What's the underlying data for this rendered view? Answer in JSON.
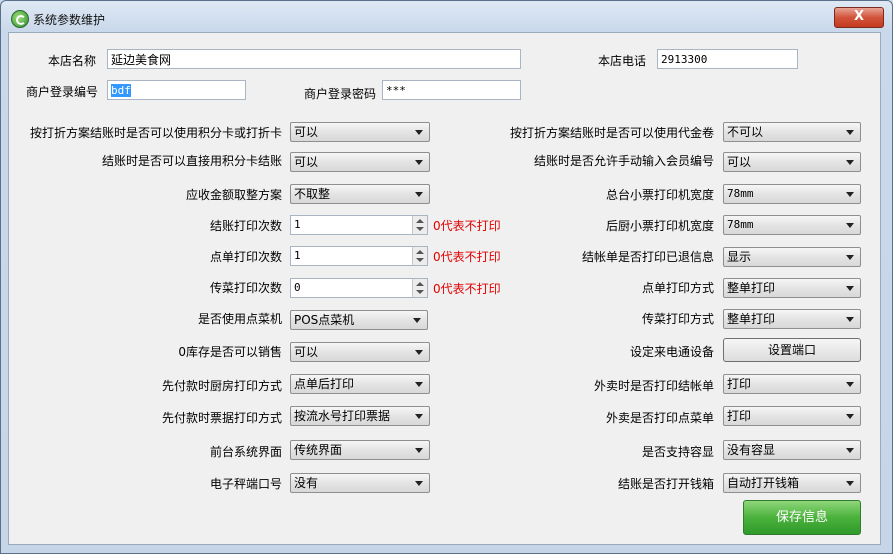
{
  "window": {
    "title": "系统参数维护",
    "close": "X"
  },
  "top": {
    "store_name_label": "本店名称",
    "store_name_value": "延边美食网",
    "store_phone_label": "本店电话",
    "store_phone_value": "2913300",
    "merchant_id_label": "商户登录编号",
    "merchant_id_value": "bdf",
    "merchant_pw_label": "商户登录密码",
    "merchant_pw_value": "***"
  },
  "left": [
    {
      "label": "按打折方案结账时是否可以使用积分卡或打折卡",
      "value": "可以"
    },
    {
      "label": "结账时是否可以直接用积分卡结账",
      "value": "可以"
    },
    {
      "label": "应收金额取整方案",
      "value": "不取整"
    },
    {
      "label": "结账打印次数",
      "value": "1",
      "note": "0代表不打印"
    },
    {
      "label": "点单打印次数",
      "value": "1",
      "note": "0代表不打印"
    },
    {
      "label": "传菜打印次数",
      "value": "0",
      "note": "0代表不打印"
    },
    {
      "label": "是否使用点菜机",
      "value": "POS点菜机"
    },
    {
      "label": "0库存是否可以销售",
      "value": "可以"
    },
    {
      "label": "先付款时厨房打印方式",
      "value": "点单后打印"
    },
    {
      "label": "先付款时票据打印方式",
      "value": "按流水号打印票据"
    },
    {
      "label": "前台系统界面",
      "value": "传统界面"
    },
    {
      "label": "电子秤端口号",
      "value": "没有"
    }
  ],
  "right": [
    {
      "label": "按打折方案结账时是否可以使用代金卷",
      "value": "不可以"
    },
    {
      "label": "结账时是否允许手动输入会员编号",
      "value": "可以"
    },
    {
      "label": "总台小票打印机宽度",
      "value": "78mm"
    },
    {
      "label": "后厨小票打印机宽度",
      "value": "78mm"
    },
    {
      "label": "结帐单是否打印已退信息",
      "value": "显示"
    },
    {
      "label": "点单打印方式",
      "value": "整单打印"
    },
    {
      "label": "传菜打印方式",
      "value": "整单打印"
    },
    {
      "label": "设定来电通设备",
      "button": "设置端口"
    },
    {
      "label": "外卖时是否打印结帐单",
      "value": "打印"
    },
    {
      "label": "外卖是否打印点菜单",
      "value": "打印"
    },
    {
      "label": "是否支持容显",
      "value": "没有容显"
    },
    {
      "label": "结账是否打开钱箱",
      "value": "自动打开钱箱"
    }
  ],
  "actions": {
    "save": "保存信息"
  }
}
